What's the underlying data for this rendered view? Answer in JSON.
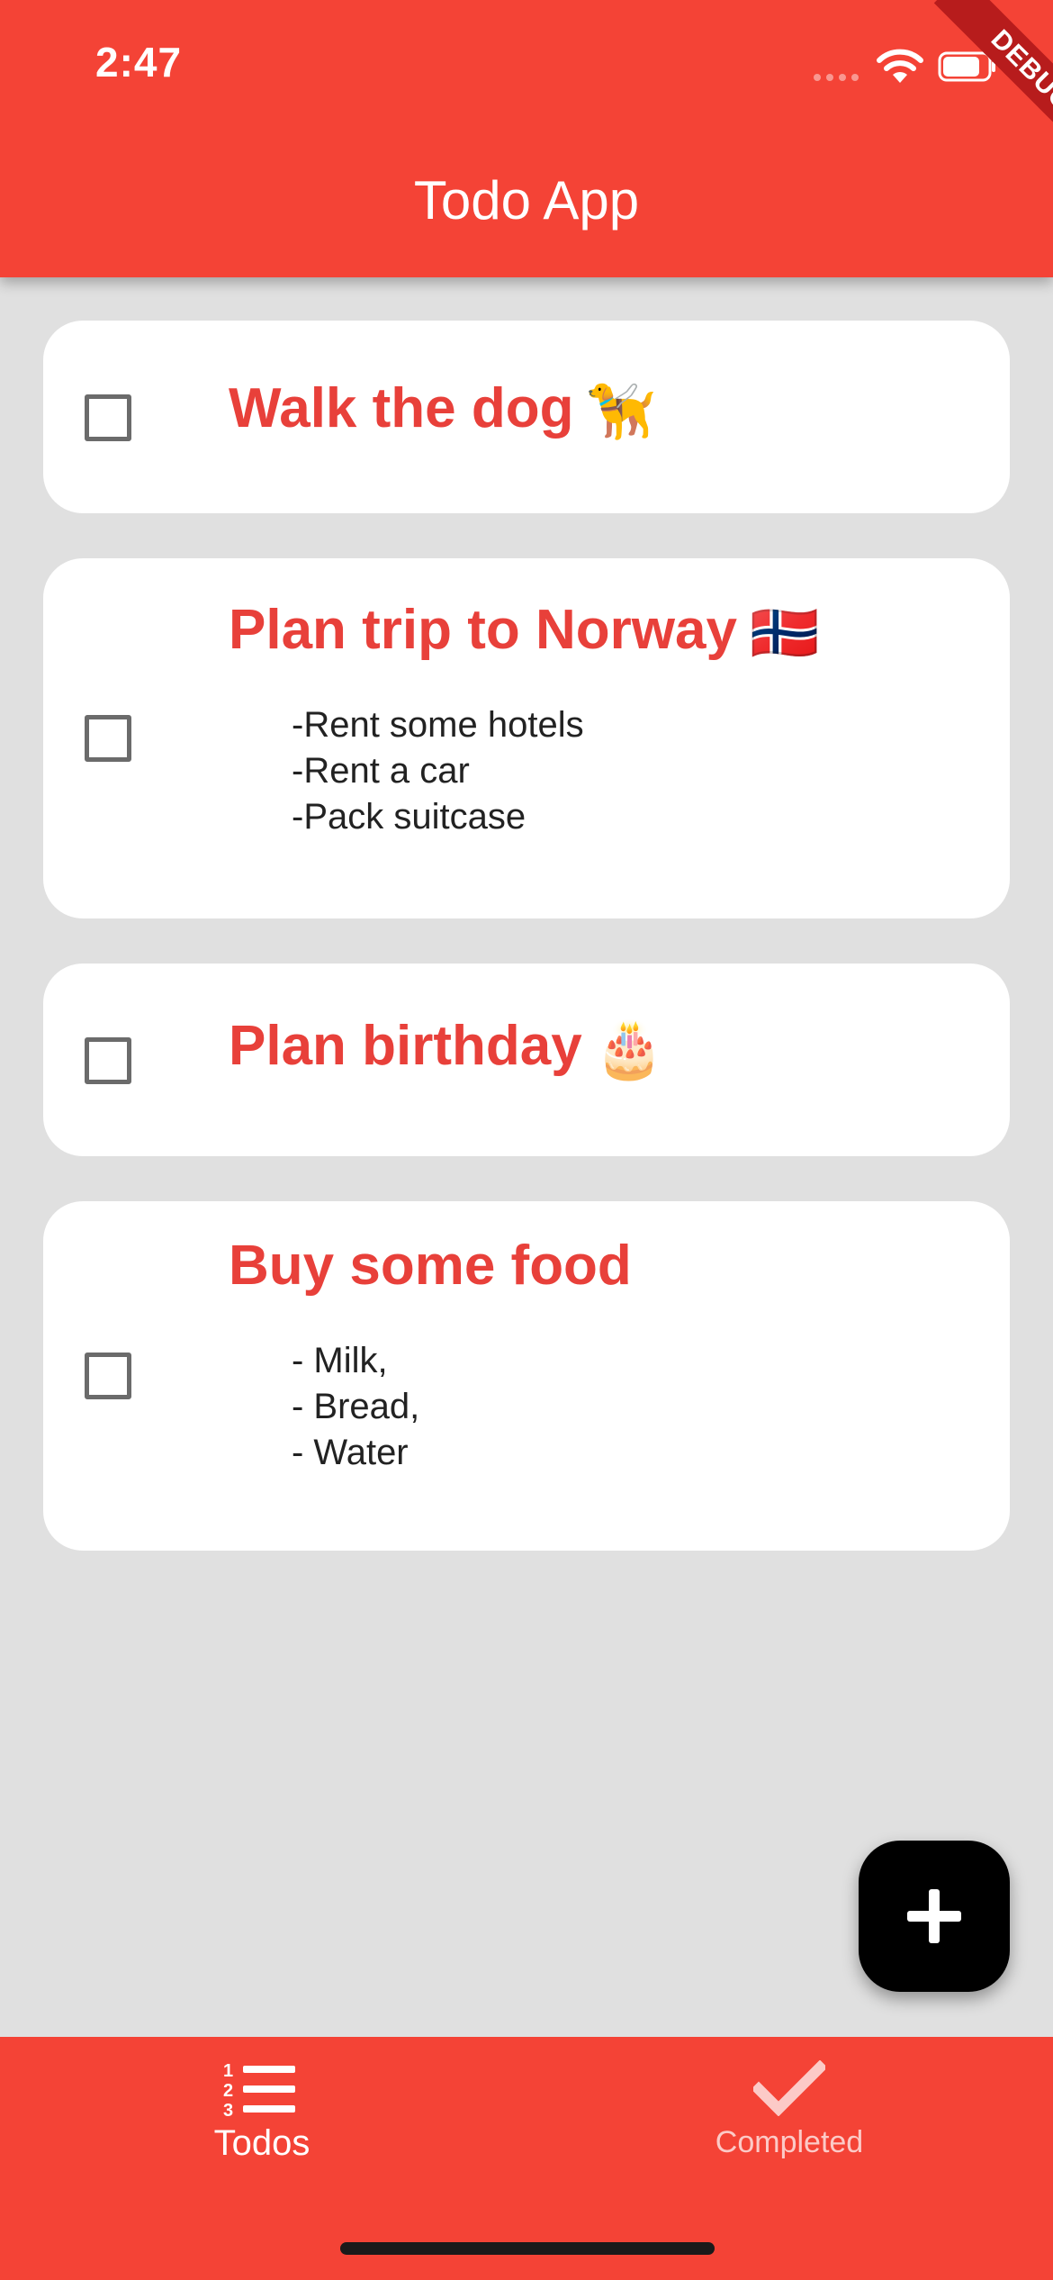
{
  "status_bar": {
    "time": "2:47",
    "debug_label": "DEBUG"
  },
  "app_bar": {
    "title": "Todo App"
  },
  "todos": [
    {
      "title": "Walk the dog",
      "emoji": "🦮",
      "notes": "",
      "checked": false
    },
    {
      "title": "Plan trip to Norway",
      "emoji": "🇳🇴",
      "notes": "-Rent some hotels\n-Rent a car\n-Pack suitcase",
      "checked": false
    },
    {
      "title": "Plan birthday",
      "emoji": "🎂",
      "notes": "",
      "checked": false
    },
    {
      "title": "Buy some food",
      "emoji": "",
      "notes": "- Milk,\n- Bread,\n- Water",
      "checked": false
    }
  ],
  "fab": {
    "icon": "plus-icon"
  },
  "bottom_nav": {
    "items": [
      {
        "label": "Todos",
        "icon": "numbered-list-icon",
        "active": true
      },
      {
        "label": "Completed",
        "icon": "check-icon",
        "active": false
      }
    ]
  },
  "colors": {
    "primary": "#f44336",
    "title_text": "#e8403a",
    "background": "#e0e0e0",
    "card": "#ffffff",
    "fab": "#000000"
  }
}
